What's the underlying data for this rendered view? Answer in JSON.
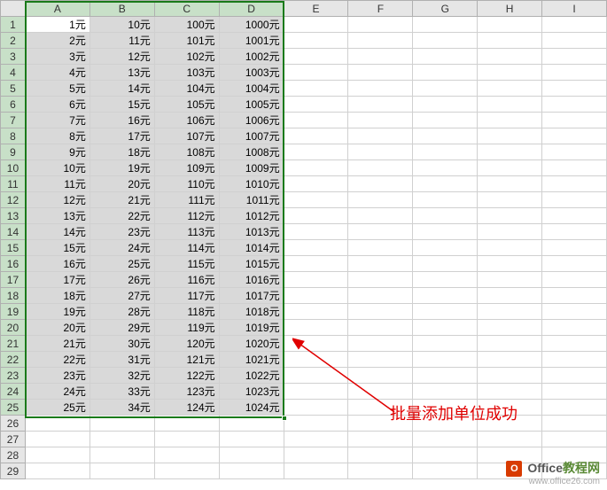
{
  "columns": [
    "A",
    "B",
    "C",
    "D",
    "E",
    "F",
    "G",
    "H",
    "I"
  ],
  "total_rows": 29,
  "data_rows": 25,
  "selected_cols": 4,
  "suffix": "元",
  "chart_data": {
    "type": "table",
    "columns": [
      "A",
      "B",
      "C",
      "D"
    ],
    "rows": [
      [
        1,
        10,
        100,
        1000
      ],
      [
        2,
        11,
        101,
        1001
      ],
      [
        3,
        12,
        102,
        1002
      ],
      [
        4,
        13,
        103,
        1003
      ],
      [
        5,
        14,
        104,
        1004
      ],
      [
        6,
        15,
        105,
        1005
      ],
      [
        7,
        16,
        106,
        1006
      ],
      [
        8,
        17,
        107,
        1007
      ],
      [
        9,
        18,
        108,
        1008
      ],
      [
        10,
        19,
        109,
        1009
      ],
      [
        11,
        20,
        110,
        1010
      ],
      [
        12,
        21,
        111,
        1011
      ],
      [
        13,
        22,
        112,
        1012
      ],
      [
        14,
        23,
        113,
        1013
      ],
      [
        15,
        24,
        114,
        1014
      ],
      [
        16,
        25,
        115,
        1015
      ],
      [
        17,
        26,
        116,
        1016
      ],
      [
        18,
        27,
        117,
        1017
      ],
      [
        19,
        28,
        118,
        1018
      ],
      [
        20,
        29,
        119,
        1019
      ],
      [
        21,
        30,
        120,
        1020
      ],
      [
        22,
        31,
        121,
        1021
      ],
      [
        23,
        32,
        122,
        1022
      ],
      [
        24,
        33,
        123,
        1023
      ],
      [
        25,
        34,
        124,
        1024
      ]
    ]
  },
  "annotation_text": "批量添加单位成功",
  "watermark": {
    "brand1": "Office",
    "brand2": "教程网",
    "url": "www.office26.com"
  }
}
